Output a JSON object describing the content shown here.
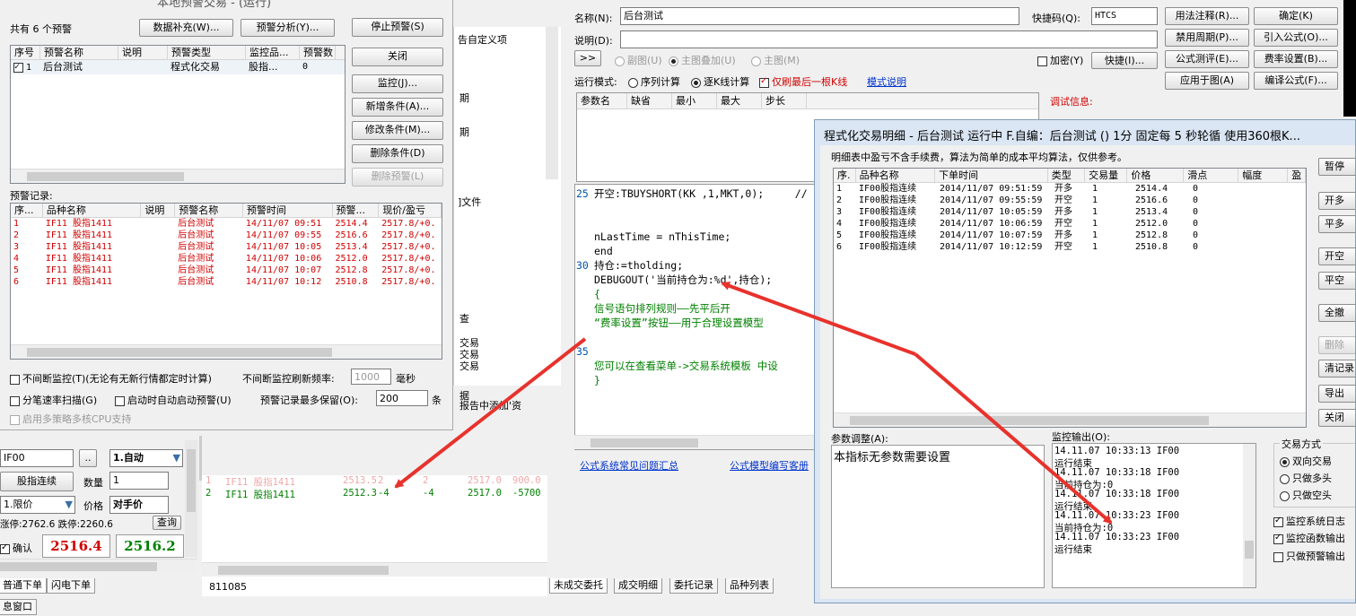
{
  "local": {
    "title": "本地预警交易 - (运行)",
    "count_label": "共有 6 个预警",
    "btn_data": "数据补充(W)...",
    "btn_analysis": "预警分析(Y)...",
    "btn_stop": "停止预警(S)",
    "btn_close": "关闭",
    "btn_monitor": "监控(J)...",
    "btn_add": "新增条件(A)...",
    "btn_modify": "修改条件(M)...",
    "btn_delete": "删除条件(D)",
    "btn_delete_warn": "删除预警(L)",
    "strat_headers": [
      "序号",
      "预警名称",
      "说明",
      "预警类型",
      "监控品...",
      "预警数"
    ],
    "strat_row": [
      "1",
      "后台测试",
      "",
      "程式化交易",
      "股指...",
      "0"
    ],
    "record_label": "预警记录:",
    "rec_headers": [
      "序...",
      "品种名称",
      "说明",
      "预警名称",
      "预警时间",
      "预警...",
      "现价/盈亏"
    ],
    "rec_rows": [
      [
        "1",
        "IF11 股指1411",
        "",
        "后台测试",
        "14/11/07 09:51",
        "2514.4",
        "2517.8/+0."
      ],
      [
        "2",
        "IF11 股指1411",
        "",
        "后台测试",
        "14/11/07 09:55",
        "2516.6",
        "2517.8/+0."
      ],
      [
        "3",
        "IF11 股指1411",
        "",
        "后台测试",
        "14/11/07 10:05",
        "2513.4",
        "2517.8/+0."
      ],
      [
        "4",
        "IF11 股指1411",
        "",
        "后台测试",
        "14/11/07 10:06",
        "2512.0",
        "2517.8/+0."
      ],
      [
        "5",
        "IF11 股指1411",
        "",
        "后台测试",
        "14/11/07 10:07",
        "2512.8",
        "2517.8/+0."
      ],
      [
        "6",
        "IF11 股指1411",
        "",
        "后台测试",
        "14/11/07 10:12",
        "2510.8",
        "2517.8/+0."
      ]
    ],
    "opt_continuous": "不间断监控(T)(无论有无新行情都定时计算)",
    "freq_label": "不间断监控刷新频率:",
    "freq_value": "1000",
    "freq_unit": "毫秒",
    "opt_tick": "分笔速率扫描(G)",
    "opt_autostart": "启动时自动启动预警(U)",
    "max_keep_label": "预警记录最多保留(O):",
    "max_keep_value": "200",
    "max_keep_unit": "条",
    "opt_cpu": "启用多策略多核CPU支持"
  },
  "order": {
    "code": "IF00",
    "dots": "..",
    "mode": "1.自动",
    "name": "股指连续",
    "qty_label": "数量",
    "qty": "1",
    "price_type": "1.限价",
    "price_label": "价格",
    "price": "对手价",
    "limits": "涨停:2762.6 跌停:2260.6",
    "query": "查询",
    "confirm": "确认",
    "bid": "2516.4",
    "ask": "2516.2",
    "tab1": "普通下单",
    "tab2": "闪电下单",
    "window_tab": "息窗口"
  },
  "mid_rows": [
    [
      "1",
      "IF11 股指1411",
      "2513.5",
      "2",
      "2",
      "2517.0",
      "900.0"
    ],
    [
      "2",
      "IF11 股指1411",
      "2512.3",
      "-4",
      "-4",
      "2517.0",
      "-5700"
    ]
  ],
  "status_num": "811085",
  "bottom_tabs": [
    "未成交委托",
    "成交明细",
    "委托记录",
    "品种列表"
  ],
  "middle_frag": [
    "告自定义项",
    "期",
    "期",
    "]文件",
    "查",
    "交易",
    "交易",
    "交易",
    "据",
    "报告中添加'资"
  ],
  "editor": {
    "name_label": "名称(N):",
    "name_value": "后台测试",
    "hotkey_label": "快捷码(Q):",
    "hotkey_value": "HTCS",
    "desc_label": "说明(D):",
    "btn_usage": "用法注释(R)...",
    "btn_ok": "确定(K)",
    "btn_period": "禁用周期(P)...",
    "btn_import": "引入公式(O)...",
    "btn_test": "公式测评(E)...",
    "btn_fee": "费率设置(B)...",
    "btn_apply": "应用于图(A)",
    "btn_compile": "编译公式(F)...",
    "btn_more": ">>",
    "opt_sub": "副图(U)",
    "opt_overlay": "主图叠加(U)",
    "opt_main": "主图(M)",
    "opt_encrypt": "加密(Y)",
    "btn_quick": "快捷(I)...",
    "run_mode": "运行模式:",
    "mode_seq": "序列计算",
    "mode_tick": "逐K线计算",
    "mode_last": "仅刷最后一根K线",
    "mode_help": "模式说明",
    "param_headers": [
      "参数名",
      "缺省",
      "最小",
      "最大",
      "步长"
    ],
    "debug_label": "调试信息:",
    "link_faq": "公式系统常见问题汇总",
    "link_guide": "公式模型编写客册"
  },
  "code_lines": [
    {
      "no": "25",
      "text": "开空:TBUYSHORT(KK ,1,MKT,0);     //",
      "color": "#000000"
    },
    {
      "no": "",
      "text": "",
      "color": "#000000"
    },
    {
      "no": "",
      "text": "",
      "color": "#000000"
    },
    {
      "no": "",
      "text": "nLastTime = nThisTime;",
      "color": "#000000"
    },
    {
      "no": "",
      "text": "end",
      "color": "#000000"
    },
    {
      "no": "30",
      "text": "持仓:=tholding;",
      "color": "#000000"
    },
    {
      "no": "",
      "text": "DEBUGOUT('当前持仓为:%d',持仓);",
      "color": "#000000"
    },
    {
      "no": "",
      "text": "{",
      "color": "#008000"
    },
    {
      "no": "",
      "text": "信号语句排列规则——先平后开",
      "color": "#008000"
    },
    {
      "no": "",
      "text": "“费率设置”按钮——用于合理设置模型",
      "color": "#008000"
    },
    {
      "no": "",
      "text": "",
      "color": "#008000"
    },
    {
      "no": "35",
      "text": "",
      "color": "#008000"
    },
    {
      "no": "",
      "text": "您可以在查看菜单->交易系统模板 中设",
      "color": "#008000"
    },
    {
      "no": "",
      "text": "}",
      "color": "#008000"
    }
  ],
  "detail": {
    "title": "程式化交易明细 - 后台测试 运行中  F.自编：后台测试 () 1分 固定每 5 秒轮循 使用360根K...",
    "note": "明细表中盈亏不含手续费，算法为简单的成本平均算法，仅供参考。",
    "headers": [
      "序.",
      "品种名称",
      "下单时间",
      "类型",
      "交易量",
      "价格",
      "滑点",
      "幅度",
      "盈"
    ],
    "rows": [
      [
        "1",
        "IF00股指连续",
        "2014/11/07 09:51:59",
        "开多",
        "1",
        "2514.4",
        "0"
      ],
      [
        "2",
        "IF00股指连续",
        "2014/11/07 09:55:59",
        "开空",
        "1",
        "2516.6",
        "0"
      ],
      [
        "3",
        "IF00股指连续",
        "2014/11/07 10:05:59",
        "开多",
        "1",
        "2513.4",
        "0"
      ],
      [
        "4",
        "IF00股指连续",
        "2014/11/07 10:06:59",
        "开空",
        "1",
        "2512.0",
        "0"
      ],
      [
        "5",
        "IF00股指连续",
        "2014/11/07 10:07:59",
        "开多",
        "1",
        "2512.8",
        "0"
      ],
      [
        "6",
        "IF00股指连续",
        "2014/11/07 10:12:59",
        "开空",
        "1",
        "2510.8",
        "0"
      ]
    ],
    "side_buttons": [
      "暂停",
      "开多",
      "平多",
      "开空",
      "平空",
      "全撤",
      "删除",
      "清记录",
      "导出",
      "关闭"
    ],
    "param_label": "参数调整(A):",
    "param_text": "本指标无参数需要设置",
    "output_label": "监控输出(O):",
    "output_lines": [
      "14.11.07 10:33:13 IF00",
      "运行结束",
      "14.11.07 10:33:18 IF00",
      "当前持仓为:0",
      "14.11.07 10:33:18 IF00",
      "运行结束",
      "14.11.07 10:33:23 IF00",
      "当前持仓为:0",
      "14.11.07 10:33:23 IF00",
      "运行结束"
    ],
    "trade_mode_label": "交易方式",
    "mode_both": "双向交易",
    "mode_long": "只做多头",
    "mode_short": "只做空头",
    "opt_log": "监控系统日志",
    "opt_func": "监控函数输出",
    "opt_warn": "只做预警输出"
  },
  "colors": {
    "red": "#d00000",
    "green": "#008000",
    "title_bg": "#dbe6f4",
    "arrow": "#e8322c",
    "link": "#0033cc"
  }
}
